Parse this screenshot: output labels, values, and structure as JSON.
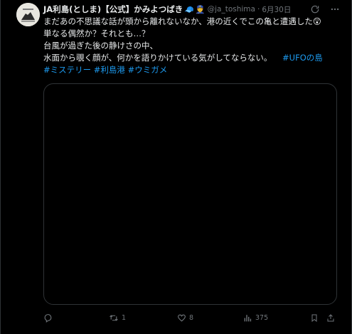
{
  "post": {
    "author": {
      "display_name": "JA利島(としま)【公式】かみよつばき",
      "emojis": [
        "🧢",
        "👮"
      ],
      "handle": "@ja_toshima",
      "separator": "·",
      "date": "6月30日"
    },
    "text_lines": [
      "まだあの不思議な話が頭から離れないなか、港の近くでこの亀と遭遇した😲",
      "単なる偶然か？それとも…？",
      "台風が過ぎた後の静けさの中、",
      "水面から覗く顔が、何かを語りかけている気がしてならない。"
    ],
    "hashtags_inline": "#UFOの島",
    "hashtags_line": [
      "#ミステリー",
      "#利島港",
      "#ウミガメ"
    ],
    "actions": {
      "reply_count": "",
      "repost_count": "1",
      "like_count": "8",
      "views_count": "375"
    }
  },
  "colors": {
    "background": "#000000",
    "text": "#e7e9ea",
    "muted": "#71767b",
    "link": "#1d9bf0",
    "border": "#2f3336"
  },
  "icons": [
    "grok-icon",
    "more-icon",
    "reply-icon",
    "repost-icon",
    "like-icon",
    "views-icon",
    "bookmark-icon",
    "share-icon"
  ]
}
